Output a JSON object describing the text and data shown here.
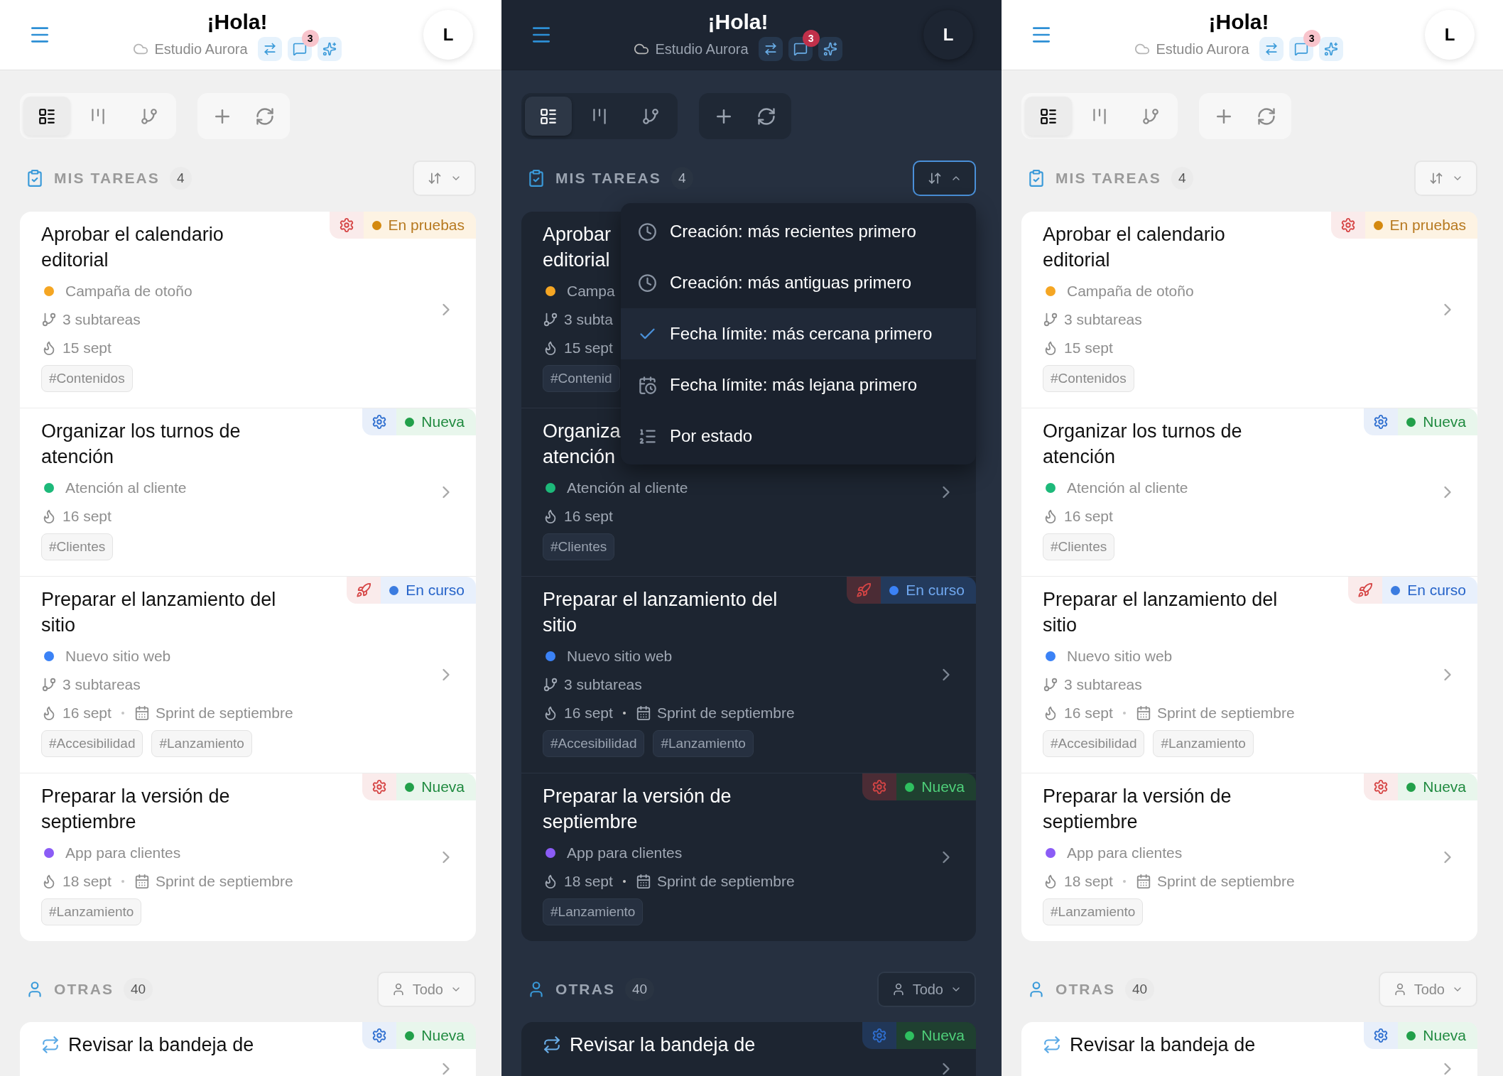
{
  "panels": [
    {
      "kind": "light",
      "header": {
        "title": "¡Hola!",
        "workspace": "Estudio Aurora",
        "message_count": "3",
        "avatar": "L"
      },
      "views": [
        {
          "kind": "list",
          "selected": true
        },
        {
          "kind": "board",
          "selected": false
        },
        {
          "kind": "tree",
          "selected": false
        }
      ],
      "my_tasks": {
        "label": "MIS TAREAS",
        "count": "4",
        "sort": {
          "expanded": false
        },
        "tasks": [
          {
            "title_lines": [
              "Aprobar el calendario",
              "editorial"
            ],
            "kind": "gear",
            "color": "#d64545",
            "status": {
              "kind": "testing",
              "label": "En pruebas"
            },
            "project": {
              "name": "Campaña de otoño",
              "color": "#f5a623"
            },
            "subtasks": "3 subtareas",
            "due": "15 sept",
            "tags": [
              "#Contenidos"
            ]
          },
          {
            "title_lines": [
              "Organizar los turnos de",
              "atención"
            ],
            "kind": "gear",
            "color": "#2f6fd0",
            "status": {
              "kind": "new",
              "label": "Nueva"
            },
            "project": {
              "name": "Atención al cliente",
              "color": "#1db97a"
            },
            "due": "16 sept",
            "tags": [
              "#Clientes"
            ]
          },
          {
            "title_lines": [
              "Preparar el lanzamiento del",
              "sitio"
            ],
            "kind": "rocket",
            "color": "#d64545",
            "status": {
              "kind": "progress",
              "label": "En curso"
            },
            "project": {
              "name": "Nuevo sitio web",
              "color": "#3b82f6"
            },
            "subtasks": "3 subtareas",
            "due": "16 sept",
            "sprint": "Sprint de septiembre",
            "tags": [
              "#Accesibilidad",
              "#Lanzamiento"
            ]
          },
          {
            "title_lines": [
              "Preparar la versión de",
              "septiembre"
            ],
            "kind": "gear",
            "color": "#d64545",
            "status": {
              "kind": "new",
              "label": "Nueva"
            },
            "project": {
              "name": "App para clientes",
              "color": "#8b5cf6"
            },
            "due": "18 sept",
            "sprint": "Sprint de septiembre",
            "tags": [
              "#Lanzamiento"
            ]
          }
        ]
      },
      "others": {
        "label": "OTRAS",
        "count": "40",
        "filter": "Todo",
        "tasks": [
          {
            "title_lines": [
              "Revisar la bandeja de"
            ],
            "recurring": true,
            "kind": "gear",
            "color": "#2f6fd0",
            "status": {
              "kind": "new",
              "label": "Nueva"
            }
          }
        ]
      }
    },
    {
      "kind": "dark",
      "header": {
        "title": "¡Hola!",
        "workspace": "Estudio Aurora",
        "message_count": "3",
        "avatar": "L"
      },
      "views": [
        {
          "kind": "list",
          "selected": true
        },
        {
          "kind": "board",
          "selected": false
        },
        {
          "kind": "tree",
          "selected": false
        }
      ],
      "my_tasks": {
        "label": "MIS TAREAS",
        "count": "4",
        "sort": {
          "expanded": true,
          "options": [
            {
              "kind": "clock",
              "label": "Creación: más recientes primero",
              "selected": false
            },
            {
              "kind": "clock",
              "label": "Creación: más antiguas primero",
              "selected": false
            },
            {
              "label": "Fecha límite: más cercana primero",
              "selected": true
            },
            {
              "kind": "calendar",
              "label": "Fecha límite: más lejana primero",
              "selected": false
            },
            {
              "kind": "list",
              "label": "Por estado",
              "selected": false
            }
          ]
        },
        "tasks": [
          {
            "title_lines": [
              "Aprobar",
              "editorial"
            ],
            "project": {
              "name": "Campa",
              "color": "#f5a623"
            },
            "subtasks": "3 subta",
            "due": "15 sept",
            "tags": [
              "#Contenid"
            ]
          },
          {
            "title_lines": [
              "Organiza",
              "atención"
            ],
            "project": {
              "name": "Atención al cliente",
              "color": "#1db97a"
            },
            "due": "16 sept",
            "tags": [
              "#Clientes"
            ]
          },
          {
            "title_lines": [
              "Preparar el lanzamiento del",
              "sitio"
            ],
            "kind": "rocket",
            "color": "#d64545",
            "status": {
              "kind": "progress",
              "label": "En curso"
            },
            "project": {
              "name": "Nuevo sitio web",
              "color": "#3b82f6"
            },
            "subtasks": "3 subtareas",
            "due": "16 sept",
            "sprint": "Sprint de septiembre",
            "tags": [
              "#Accesibilidad",
              "#Lanzamiento"
            ]
          },
          {
            "title_lines": [
              "Preparar la versión de",
              "septiembre"
            ],
            "kind": "gear",
            "color": "#d64545",
            "status": {
              "kind": "new",
              "label": "Nueva"
            },
            "project": {
              "name": "App para clientes",
              "color": "#8b5cf6"
            },
            "due": "18 sept",
            "sprint": "Sprint de septiembre",
            "tags": [
              "#Lanzamiento"
            ]
          }
        ]
      },
      "others": {
        "label": "OTRAS",
        "count": "40",
        "filter": "Todo",
        "tasks": [
          {
            "title_lines": [
              "Revisar la bandeja de"
            ],
            "recurring": true,
            "kind": "gear",
            "color": "#2f6fd0",
            "status": {
              "kind": "new",
              "label": "Nueva"
            }
          }
        ]
      }
    },
    {
      "kind": "light",
      "header": {
        "title": "¡Hola!",
        "workspace": "Estudio Aurora",
        "message_count": "3",
        "avatar": "L"
      },
      "views": [
        {
          "kind": "list",
          "selected": true
        },
        {
          "kind": "board",
          "selected": false
        },
        {
          "kind": "tree",
          "selected": false
        }
      ],
      "my_tasks": {
        "label": "MIS TAREAS",
        "count": "4",
        "sort": {
          "expanded": false
        },
        "tasks": [
          {
            "title_lines": [
              "Aprobar el calendario",
              "editorial"
            ],
            "kind": "gear",
            "color": "#d64545",
            "status": {
              "kind": "testing",
              "label": "En pruebas"
            },
            "project": {
              "name": "Campaña de otoño",
              "color": "#f5a623"
            },
            "subtasks": "3 subtareas",
            "due": "15 sept",
            "tags": [
              "#Contenidos"
            ]
          },
          {
            "title_lines": [
              "Organizar los turnos de",
              "atención"
            ],
            "kind": "gear",
            "color": "#2f6fd0",
            "status": {
              "kind": "new",
              "label": "Nueva"
            },
            "project": {
              "name": "Atención al cliente",
              "color": "#1db97a"
            },
            "due": "16 sept",
            "tags": [
              "#Clientes"
            ]
          },
          {
            "title_lines": [
              "Preparar el lanzamiento del",
              "sitio"
            ],
            "kind": "rocket",
            "color": "#d64545",
            "status": {
              "kind": "progress",
              "label": "En curso"
            },
            "project": {
              "name": "Nuevo sitio web",
              "color": "#3b82f6"
            },
            "subtasks": "3 subtareas",
            "due": "16 sept",
            "sprint": "Sprint de septiembre",
            "tags": [
              "#Accesibilidad",
              "#Lanzamiento"
            ]
          },
          {
            "title_lines": [
              "Preparar la versión de",
              "septiembre"
            ],
            "kind": "gear",
            "color": "#d64545",
            "status": {
              "kind": "new",
              "label": "Nueva"
            },
            "project": {
              "name": "App para clientes",
              "color": "#8b5cf6"
            },
            "due": "18 sept",
            "sprint": "Sprint de septiembre",
            "tags": [
              "#Lanzamiento"
            ]
          }
        ]
      },
      "others": {
        "label": "OTRAS",
        "count": "40",
        "filter": "Todo",
        "tasks": [
          {
            "title_lines": [
              "Revisar la bandeja de"
            ],
            "recurring": true,
            "kind": "gear",
            "color": "#2f6fd0",
            "status": {
              "kind": "new",
              "label": "Nueva"
            }
          }
        ]
      }
    }
  ]
}
